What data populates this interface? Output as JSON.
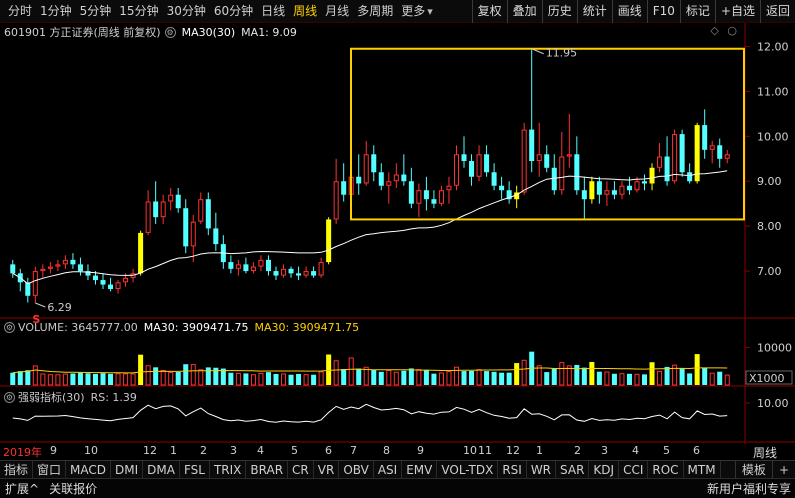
{
  "toolbar": {
    "left_items": [
      "分时",
      "1分钟",
      "5分钟",
      "15分钟",
      "30分钟",
      "60分钟",
      "日线",
      "周线",
      "月线",
      "多周期",
      "更多"
    ],
    "active_index": 7,
    "right_buttons": [
      "复权",
      "叠加",
      "历史",
      "统计",
      "画线",
      "F10",
      "标记",
      "+自选",
      "返回"
    ]
  },
  "info": {
    "stock": "601901 方正证券(周线 前复权)",
    "ma_label": "MA30(30)",
    "ma1": "MA1: 9.09"
  },
  "price_axis": {
    "labels": [
      "12.00",
      "11.00",
      "10.00",
      "9.00",
      "8.00",
      "7.00"
    ]
  },
  "annotations": {
    "high": "11.95",
    "low": "6.29",
    "low_marker": "S"
  },
  "volume": {
    "label": "VOLUME: 3645777.00",
    "ma_white": "MA30: 3909471.75",
    "ma_yellow": "MA30: 3909471.75",
    "axis_label": "10000",
    "unit": "X1000"
  },
  "rs": {
    "label": "强弱指标(30)",
    "value": "RS: 1.39",
    "axis_label": "10.00"
  },
  "time_axis": [
    "2019年",
    "9",
    "10",
    "12",
    "1",
    "2",
    "3",
    "4",
    "5",
    "6",
    "7",
    "8",
    "9",
    "10",
    "11",
    "12",
    "1",
    "2",
    "3",
    "4",
    "5",
    "6"
  ],
  "period_label": "周线",
  "bottom_tabs": [
    "指标",
    "窗口",
    "MACD",
    "DMI",
    "DMA",
    "FSL",
    "TRIX",
    "BRAR",
    "CR",
    "VR",
    "OBV",
    "ASI",
    "EMV",
    "VOL-TDX",
    "RSI",
    "WR",
    "SAR",
    "KDJ",
    "CCI",
    "ROC",
    "MTM"
  ],
  "bottom_right": [
    "模板",
    "+"
  ],
  "bottom_links": [
    "扩展^",
    "关联报价"
  ],
  "bottom_promo": "新用户福利专享",
  "colors": {
    "up": "#ff3232",
    "down": "#54ffff",
    "limit": "#ffff00",
    "box": "#ffd000",
    "ma": "#ffffff",
    "vol_ma": "#ffd000"
  },
  "chart_data": {
    "type": "candlestick",
    "y_range": [
      6.0,
      12.1
    ],
    "weeks": [
      {
        "o": 7.15,
        "h": 7.25,
        "l": 6.85,
        "c": 6.95
      },
      {
        "o": 6.95,
        "h": 7.05,
        "l": 6.55,
        "c": 6.75
      },
      {
        "o": 6.75,
        "h": 6.85,
        "l": 6.3,
        "c": 6.45
      },
      {
        "o": 6.45,
        "h": 7.1,
        "l": 6.29,
        "c": 7.0
      },
      {
        "o": 7.0,
        "h": 7.15,
        "l": 6.85,
        "c": 7.05
      },
      {
        "o": 7.05,
        "h": 7.2,
        "l": 6.95,
        "c": 7.1
      },
      {
        "o": 7.1,
        "h": 7.25,
        "l": 7.0,
        "c": 7.15
      },
      {
        "o": 7.15,
        "h": 7.35,
        "l": 7.05,
        "c": 7.25
      },
      {
        "o": 7.25,
        "h": 7.4,
        "l": 7.05,
        "c": 7.15
      },
      {
        "o": 7.15,
        "h": 7.3,
        "l": 6.9,
        "c": 7.0
      },
      {
        "o": 7.0,
        "h": 7.15,
        "l": 6.8,
        "c": 6.9
      },
      {
        "o": 6.9,
        "h": 7.0,
        "l": 6.7,
        "c": 6.8
      },
      {
        "o": 6.8,
        "h": 6.95,
        "l": 6.6,
        "c": 6.7
      },
      {
        "o": 6.7,
        "h": 6.85,
        "l": 6.55,
        "c": 6.6
      },
      {
        "o": 6.6,
        "h": 6.8,
        "l": 6.5,
        "c": 6.75
      },
      {
        "o": 6.75,
        "h": 6.95,
        "l": 6.65,
        "c": 6.85
      },
      {
        "o": 6.85,
        "h": 7.05,
        "l": 6.75,
        "c": 6.95
      },
      {
        "o": 6.95,
        "h": 7.9,
        "l": 6.9,
        "c": 7.85
      },
      {
        "o": 7.85,
        "h": 8.8,
        "l": 7.8,
        "c": 8.55
      },
      {
        "o": 8.55,
        "h": 9.0,
        "l": 8.05,
        "c": 8.2
      },
      {
        "o": 8.2,
        "h": 8.7,
        "l": 8.05,
        "c": 8.55
      },
      {
        "o": 8.55,
        "h": 8.85,
        "l": 8.35,
        "c": 8.7
      },
      {
        "o": 8.7,
        "h": 8.85,
        "l": 8.3,
        "c": 8.4
      },
      {
        "o": 8.4,
        "h": 8.6,
        "l": 7.4,
        "c": 7.55
      },
      {
        "o": 7.55,
        "h": 8.25,
        "l": 7.2,
        "c": 8.1
      },
      {
        "o": 8.1,
        "h": 8.75,
        "l": 8.05,
        "c": 8.6
      },
      {
        "o": 8.6,
        "h": 8.75,
        "l": 7.8,
        "c": 7.95
      },
      {
        "o": 7.95,
        "h": 8.3,
        "l": 7.45,
        "c": 7.6
      },
      {
        "o": 7.6,
        "h": 7.8,
        "l": 7.05,
        "c": 7.2
      },
      {
        "o": 7.2,
        "h": 7.35,
        "l": 6.95,
        "c": 7.05
      },
      {
        "o": 7.05,
        "h": 7.25,
        "l": 6.9,
        "c": 7.15
      },
      {
        "o": 7.15,
        "h": 7.3,
        "l": 6.95,
        "c": 7.0
      },
      {
        "o": 7.0,
        "h": 7.2,
        "l": 6.95,
        "c": 7.1
      },
      {
        "o": 7.1,
        "h": 7.35,
        "l": 7.0,
        "c": 7.25
      },
      {
        "o": 7.25,
        "h": 7.35,
        "l": 6.9,
        "c": 7.0
      },
      {
        "o": 7.0,
        "h": 7.1,
        "l": 6.8,
        "c": 6.9
      },
      {
        "o": 6.9,
        "h": 7.15,
        "l": 6.85,
        "c": 7.05
      },
      {
        "o": 7.05,
        "h": 7.1,
        "l": 6.85,
        "c": 6.95
      },
      {
        "o": 6.95,
        "h": 7.1,
        "l": 6.8,
        "c": 6.9
      },
      {
        "o": 6.9,
        "h": 7.1,
        "l": 6.85,
        "c": 7.0
      },
      {
        "o": 7.0,
        "h": 7.1,
        "l": 6.85,
        "c": 6.9
      },
      {
        "o": 6.9,
        "h": 7.3,
        "l": 6.85,
        "c": 7.2
      },
      {
        "o": 7.2,
        "h": 8.2,
        "l": 7.15,
        "c": 8.15
      },
      {
        "o": 8.15,
        "h": 9.5,
        "l": 8.05,
        "c": 9.0
      },
      {
        "o": 9.0,
        "h": 9.4,
        "l": 8.55,
        "c": 8.7
      },
      {
        "o": 8.7,
        "h": 10.3,
        "l": 8.5,
        "c": 9.1
      },
      {
        "o": 9.1,
        "h": 9.6,
        "l": 8.7,
        "c": 8.95
      },
      {
        "o": 8.95,
        "h": 9.9,
        "l": 8.9,
        "c": 9.6
      },
      {
        "o": 9.6,
        "h": 9.8,
        "l": 9.0,
        "c": 9.2
      },
      {
        "o": 9.2,
        "h": 9.4,
        "l": 8.8,
        "c": 8.9
      },
      {
        "o": 8.9,
        "h": 9.2,
        "l": 8.5,
        "c": 9.0
      },
      {
        "o": 9.0,
        "h": 9.4,
        "l": 8.85,
        "c": 9.15
      },
      {
        "o": 9.15,
        "h": 9.6,
        "l": 8.9,
        "c": 9.0
      },
      {
        "o": 9.0,
        "h": 9.3,
        "l": 8.4,
        "c": 8.5
      },
      {
        "o": 8.5,
        "h": 8.95,
        "l": 8.2,
        "c": 8.8
      },
      {
        "o": 8.8,
        "h": 9.1,
        "l": 8.35,
        "c": 8.6
      },
      {
        "o": 8.6,
        "h": 8.8,
        "l": 8.4,
        "c": 8.5
      },
      {
        "o": 8.5,
        "h": 8.9,
        "l": 8.45,
        "c": 8.8
      },
      {
        "o": 8.8,
        "h": 9.1,
        "l": 8.5,
        "c": 8.9
      },
      {
        "o": 8.9,
        "h": 9.8,
        "l": 8.8,
        "c": 9.6
      },
      {
        "o": 9.6,
        "h": 10.0,
        "l": 9.3,
        "c": 9.45
      },
      {
        "o": 9.45,
        "h": 9.6,
        "l": 8.9,
        "c": 9.1
      },
      {
        "o": 9.1,
        "h": 9.8,
        "l": 9.0,
        "c": 9.6
      },
      {
        "o": 9.6,
        "h": 9.8,
        "l": 9.1,
        "c": 9.2
      },
      {
        "o": 9.2,
        "h": 9.4,
        "l": 8.8,
        "c": 8.9
      },
      {
        "o": 8.9,
        "h": 9.1,
        "l": 8.6,
        "c": 8.8
      },
      {
        "o": 8.8,
        "h": 9.0,
        "l": 8.5,
        "c": 8.6
      },
      {
        "o": 8.6,
        "h": 8.9,
        "l": 8.4,
        "c": 8.75
      },
      {
        "o": 8.75,
        "h": 10.3,
        "l": 8.7,
        "c": 10.15
      },
      {
        "o": 10.15,
        "h": 11.95,
        "l": 9.2,
        "c": 9.45
      },
      {
        "o": 9.45,
        "h": 10.3,
        "l": 9.1,
        "c": 9.6
      },
      {
        "o": 9.6,
        "h": 9.8,
        "l": 9.2,
        "c": 9.3
      },
      {
        "o": 9.3,
        "h": 9.6,
        "l": 8.7,
        "c": 8.8
      },
      {
        "o": 8.8,
        "h": 10.1,
        "l": 8.7,
        "c": 9.55
      },
      {
        "o": 9.55,
        "h": 10.5,
        "l": 9.3,
        "c": 9.6
      },
      {
        "o": 9.6,
        "h": 10.0,
        "l": 8.7,
        "c": 8.8
      },
      {
        "o": 8.8,
        "h": 9.1,
        "l": 8.15,
        "c": 8.6
      },
      {
        "o": 8.6,
        "h": 9.1,
        "l": 8.5,
        "c": 9.0
      },
      {
        "o": 9.0,
        "h": 9.1,
        "l": 8.5,
        "c": 8.7
      },
      {
        "o": 8.7,
        "h": 9.0,
        "l": 8.45,
        "c": 8.8
      },
      {
        "o": 8.8,
        "h": 9.0,
        "l": 8.6,
        "c": 8.7
      },
      {
        "o": 8.7,
        "h": 9.0,
        "l": 8.6,
        "c": 8.9
      },
      {
        "o": 8.9,
        "h": 9.1,
        "l": 8.7,
        "c": 8.8
      },
      {
        "o": 8.8,
        "h": 9.1,
        "l": 8.75,
        "c": 9.0
      },
      {
        "o": 9.0,
        "h": 9.15,
        "l": 8.8,
        "c": 8.95
      },
      {
        "o": 8.95,
        "h": 9.4,
        "l": 8.8,
        "c": 9.3
      },
      {
        "o": 9.3,
        "h": 9.85,
        "l": 9.2,
        "c": 9.55
      },
      {
        "o": 9.55,
        "h": 10.0,
        "l": 8.9,
        "c": 9.0
      },
      {
        "o": 9.0,
        "h": 10.15,
        "l": 8.95,
        "c": 10.05
      },
      {
        "o": 10.05,
        "h": 10.15,
        "l": 9.1,
        "c": 9.2
      },
      {
        "o": 9.2,
        "h": 9.4,
        "l": 8.95,
        "c": 9.0
      },
      {
        "o": 9.0,
        "h": 10.3,
        "l": 8.95,
        "c": 10.25
      },
      {
        "o": 10.25,
        "h": 10.6,
        "l": 9.5,
        "c": 9.7
      },
      {
        "o": 9.7,
        "h": 9.9,
        "l": 9.4,
        "c": 9.8
      },
      {
        "o": 9.8,
        "h": 9.95,
        "l": 9.3,
        "c": 9.5
      },
      {
        "o": 9.5,
        "h": 9.7,
        "l": 9.4,
        "c": 9.6
      }
    ],
    "limit_up_weeks": [
      17,
      42,
      67,
      77,
      85,
      91
    ],
    "highlight_range": {
      "price_low": 8.15,
      "price_high": 11.95
    }
  }
}
